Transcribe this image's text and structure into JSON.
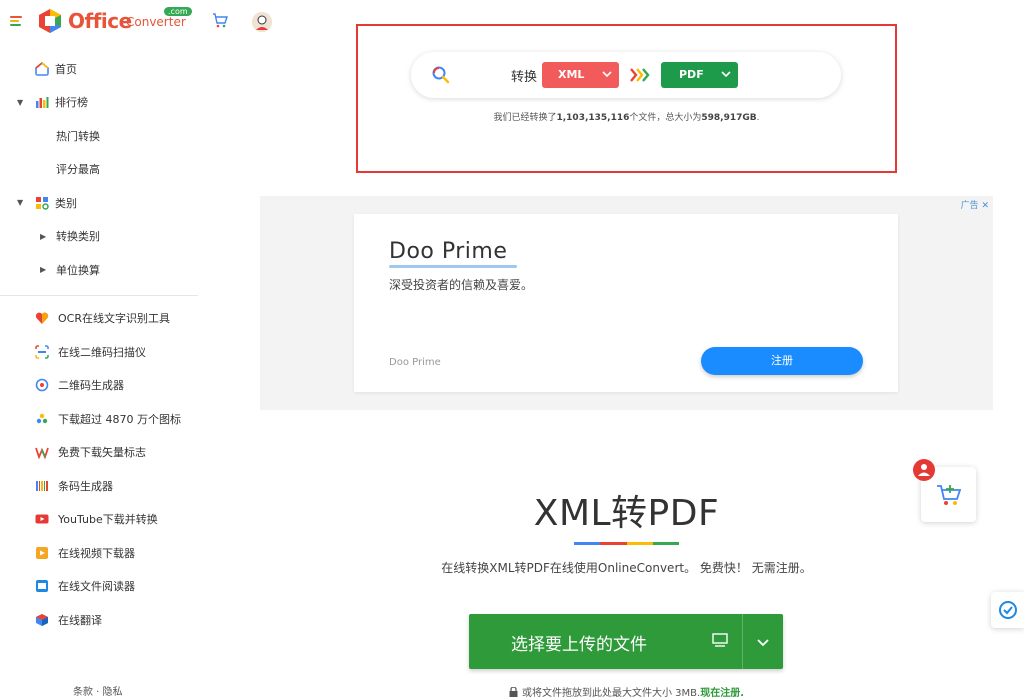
{
  "header": {
    "logo_text": "Office",
    "logo_sub": "Converter",
    "logo_com": ".com"
  },
  "sidebar": {
    "items": [
      {
        "label": "首页"
      },
      {
        "label": "排行榜"
      },
      {
        "label": "热门转换"
      },
      {
        "label": "评分最高"
      },
      {
        "label": "类别"
      },
      {
        "label": "转换类别"
      },
      {
        "label": "单位换算"
      }
    ],
    "tools": [
      {
        "label": "OCR在线文字识别工具"
      },
      {
        "label": "在线二维码扫描仪"
      },
      {
        "label": "二维码生成器"
      },
      {
        "label": "下载超过 4870 万个图标"
      },
      {
        "label": "免费下载矢量标志"
      },
      {
        "label": "条码生成器"
      },
      {
        "label": "YouTube下载并转换"
      },
      {
        "label": "在线视频下载器"
      },
      {
        "label": "在线文件阅读器"
      },
      {
        "label": "在线翻译"
      }
    ],
    "footer": "条款 · 隐私"
  },
  "search": {
    "convert_label": "转换",
    "from_format": "XML",
    "to_format": "PDF",
    "stats_prefix": "我们已经转换了",
    "files_count": "1,103,135,116",
    "stats_mid": "个文件，总大小为",
    "total_size": "598,917GB",
    "stats_suffix": "."
  },
  "ad": {
    "tag": "广告",
    "title": "Doo Prime",
    "subtitle": "深受投资者的信赖及喜爱。",
    "brand": "Doo Prime",
    "button": "注册"
  },
  "main": {
    "title": "XML转PDF",
    "description": "在线转换XML转PDF在线使用OnlineConvert。 免费快！ 无需注册。",
    "upload_button": "选择要上传的文件",
    "drop_note": "或将文件拖放到此处最大文件大小 3MB.",
    "register_link": "现在注册."
  },
  "colors": {
    "accent_red": "#e53935",
    "from_btn": "#f25b5b",
    "to_btn": "#1e9a4b",
    "upload_btn": "#2e9a39",
    "ad_btn": "#1a8cff"
  }
}
